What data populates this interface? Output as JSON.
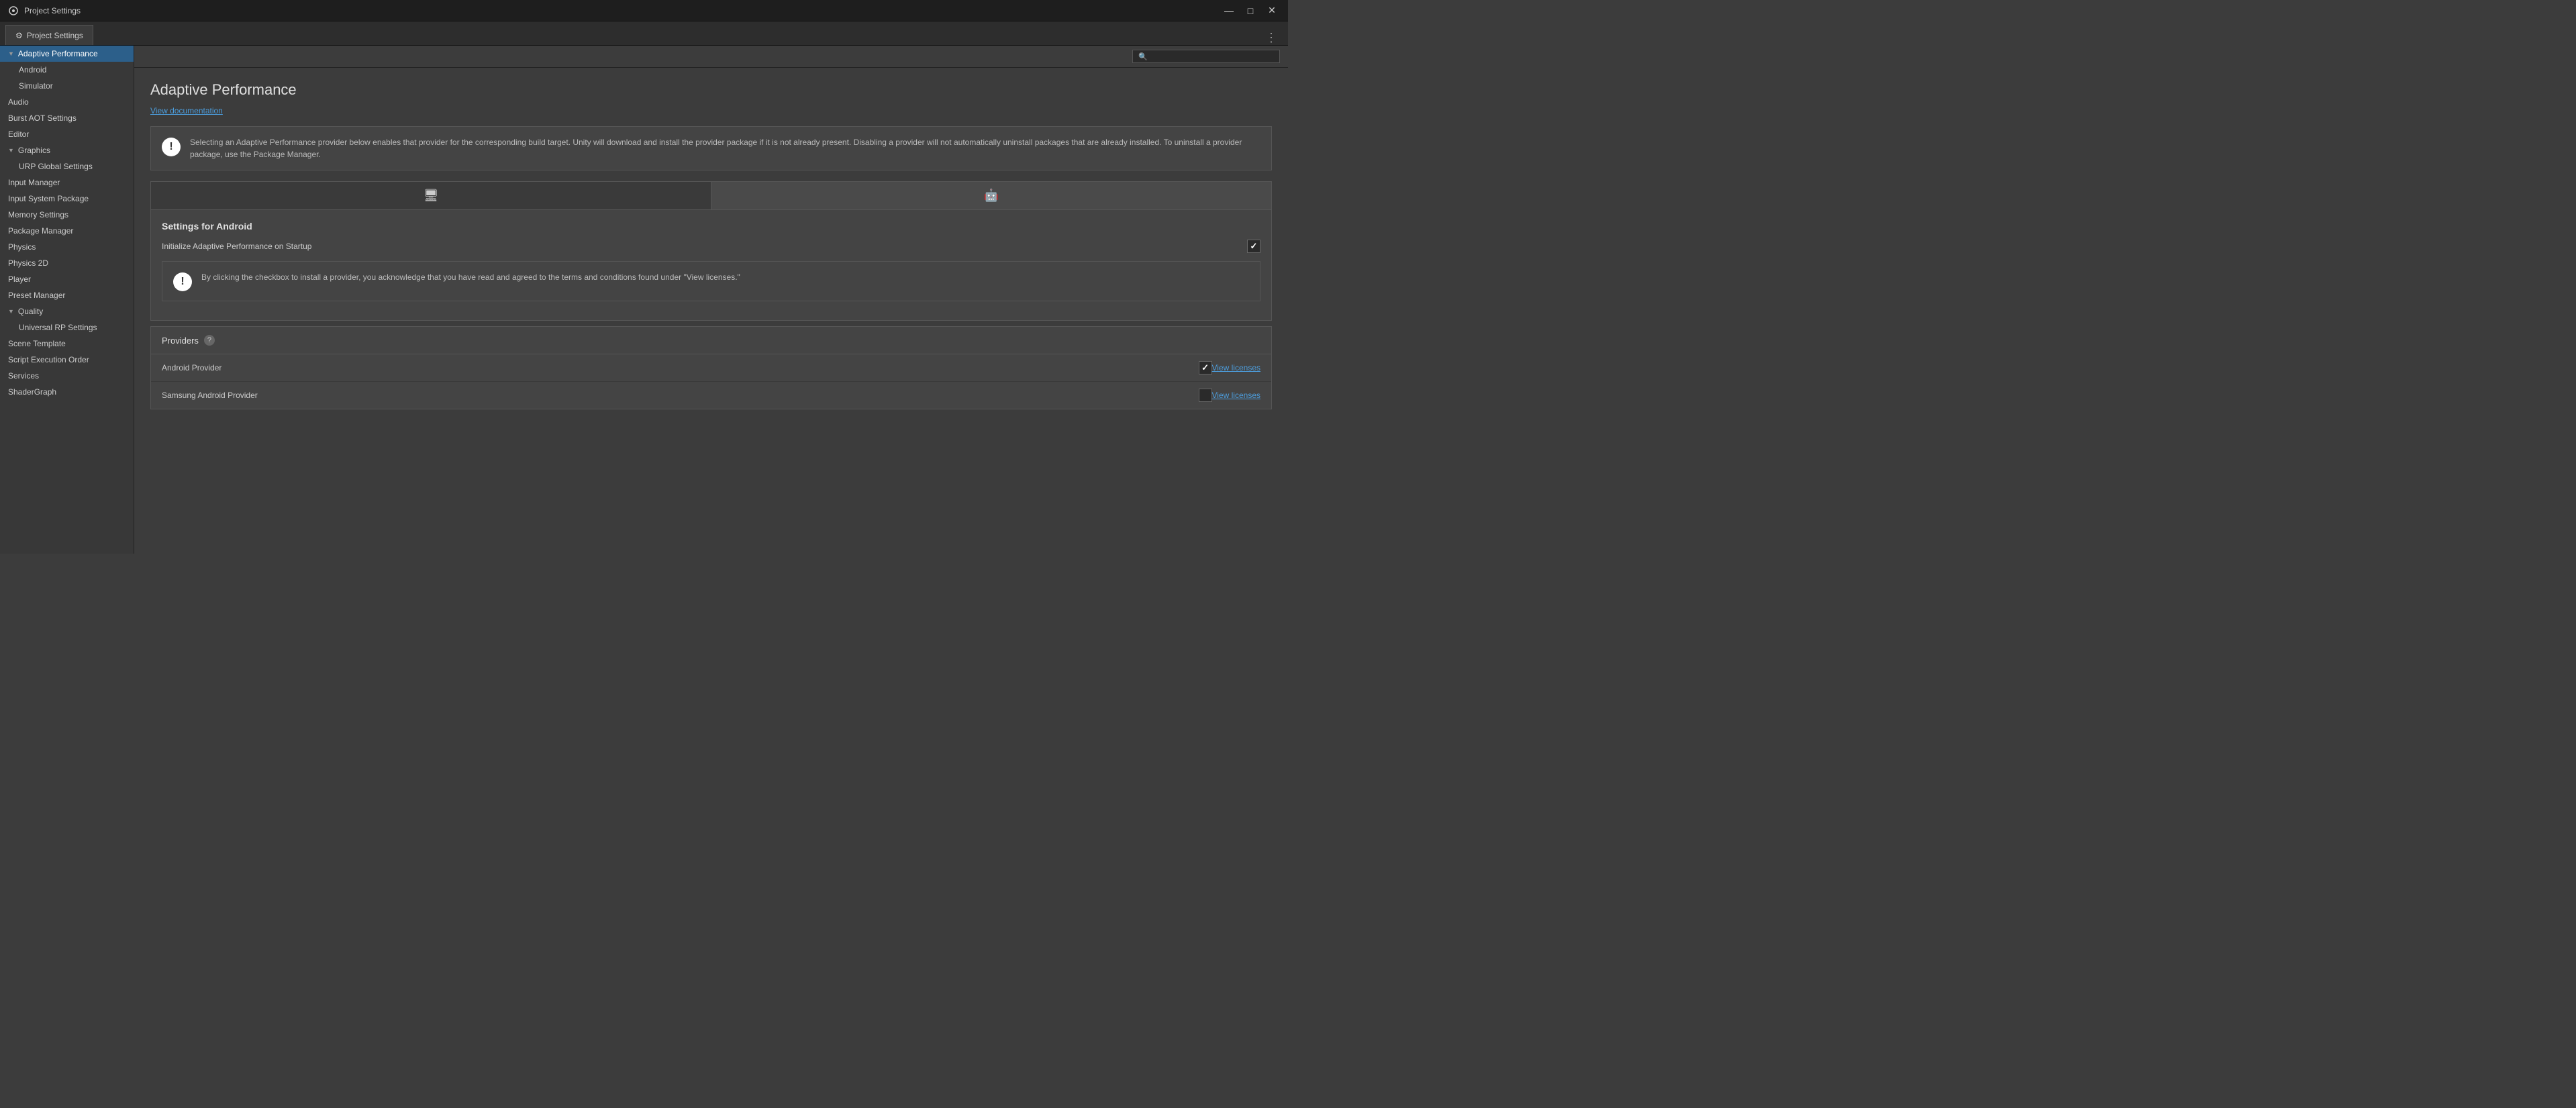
{
  "titleBar": {
    "icon": "⚙",
    "title": "Project Settings",
    "controls": {
      "minimize": "—",
      "maximize": "□",
      "close": "✕"
    }
  },
  "tab": {
    "icon": "⚙",
    "label": "Project Settings",
    "moreIcon": "⋮"
  },
  "search": {
    "placeholder": "",
    "icon": "🔍"
  },
  "sidebar": {
    "items": [
      {
        "id": "adaptive-performance",
        "label": "Adaptive Performance",
        "level": 0,
        "expanded": true,
        "active": true,
        "hasArrow": true
      },
      {
        "id": "android",
        "label": "Android",
        "level": 1,
        "active": false
      },
      {
        "id": "simulator",
        "label": "Simulator",
        "level": 1,
        "active": false
      },
      {
        "id": "audio",
        "label": "Audio",
        "level": 0,
        "active": false
      },
      {
        "id": "burst-aot",
        "label": "Burst AOT Settings",
        "level": 0,
        "active": false
      },
      {
        "id": "editor",
        "label": "Editor",
        "level": 0,
        "active": false
      },
      {
        "id": "graphics",
        "label": "Graphics",
        "level": 0,
        "expanded": true,
        "active": false,
        "hasArrow": true
      },
      {
        "id": "urp-global",
        "label": "URP Global Settings",
        "level": 1,
        "active": false
      },
      {
        "id": "input-manager",
        "label": "Input Manager",
        "level": 0,
        "active": false
      },
      {
        "id": "input-system",
        "label": "Input System Package",
        "level": 0,
        "active": false
      },
      {
        "id": "memory-settings",
        "label": "Memory Settings",
        "level": 0,
        "active": false
      },
      {
        "id": "package-manager",
        "label": "Package Manager",
        "level": 0,
        "active": false
      },
      {
        "id": "physics",
        "label": "Physics",
        "level": 0,
        "active": false
      },
      {
        "id": "physics-2d",
        "label": "Physics 2D",
        "level": 0,
        "active": false
      },
      {
        "id": "player",
        "label": "Player",
        "level": 0,
        "active": false
      },
      {
        "id": "preset-manager",
        "label": "Preset Manager",
        "level": 0,
        "active": false
      },
      {
        "id": "quality",
        "label": "Quality",
        "level": 0,
        "expanded": true,
        "active": false,
        "hasArrow": true
      },
      {
        "id": "universal-rp",
        "label": "Universal RP Settings",
        "level": 1,
        "active": false
      },
      {
        "id": "scene-template",
        "label": "Scene Template",
        "level": 0,
        "active": false
      },
      {
        "id": "script-execution",
        "label": "Script Execution Order",
        "level": 0,
        "active": false
      },
      {
        "id": "services",
        "label": "Services",
        "level": 0,
        "active": false
      },
      {
        "id": "shadergraph",
        "label": "ShaderGraph",
        "level": 0,
        "active": false
      }
    ]
  },
  "content": {
    "title": "Adaptive Performance",
    "docLink": "View documentation",
    "infoMessage": "Selecting an Adaptive Performance provider below enables that provider for the corresponding build target. Unity will download and install the provider package if it is not already present. Disabling a provider will not automatically uninstall packages that are already installed. To uninstall a provider package, use the Package Manager.",
    "platformTabs": [
      {
        "id": "desktop",
        "icon": "🖥",
        "active": false
      },
      {
        "id": "android",
        "icon": "📱",
        "active": true
      }
    ],
    "androidSettings": {
      "sectionTitle": "Settings for Android",
      "initLabel": "Initialize Adaptive Performance on Startup",
      "initChecked": true
    },
    "warningMessage": "By clicking the checkbox to install a provider, you acknowledge that you have read and agreed to the terms and conditions found under \"View licenses.\"",
    "providers": {
      "title": "Providers",
      "helpIcon": "?",
      "items": [
        {
          "name": "Android Provider",
          "checked": true,
          "viewLicensesLabel": "View licenses"
        },
        {
          "name": "Samsung Android Provider",
          "checked": false,
          "viewLicensesLabel": "View licenses"
        }
      ]
    }
  }
}
